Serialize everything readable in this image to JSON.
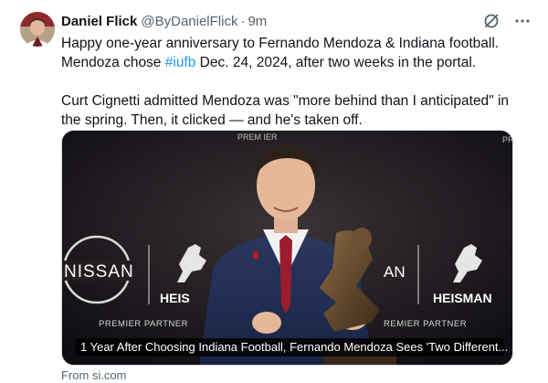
{
  "tweet": {
    "author_name": "Daniel Flick",
    "author_handle": "@ByDanielFlick",
    "separator": "·",
    "time": "9m",
    "line1": "Happy one-year anniversary to Fernando Mendoza & Indiana football.",
    "line2_before": "Mendoza chose ",
    "hashtag": "#iufb",
    "line2_after": " Dec. 24, 2024, after two weeks in the portal.",
    "line3": "Curt Cignetti admitted Mendoza was \"more behind than I anticipated\" in",
    "line4": "the spring. Then, it clicked — and he's taken off."
  },
  "card": {
    "caption": "1 Year After Choosing Indiana Football, Fernando Mendoza Sees 'Two Different...",
    "backdrop_left_logo": "NISSAN",
    "backdrop_left_heisman": "HEIS",
    "backdrop_right_an": "AN",
    "backdrop_right_heisman": "HEISMAN",
    "partner_left": "PREMIER PARTNER",
    "partner_right": "REMIER PARTNER",
    "top_text": "PREM    IER",
    "top_right_text": "PR"
  },
  "source": "From si.com",
  "icons": {
    "grok": "grok-icon",
    "more": "more-icon"
  },
  "colors": {
    "link": "#1d9bf0",
    "secondary": "#536471"
  }
}
